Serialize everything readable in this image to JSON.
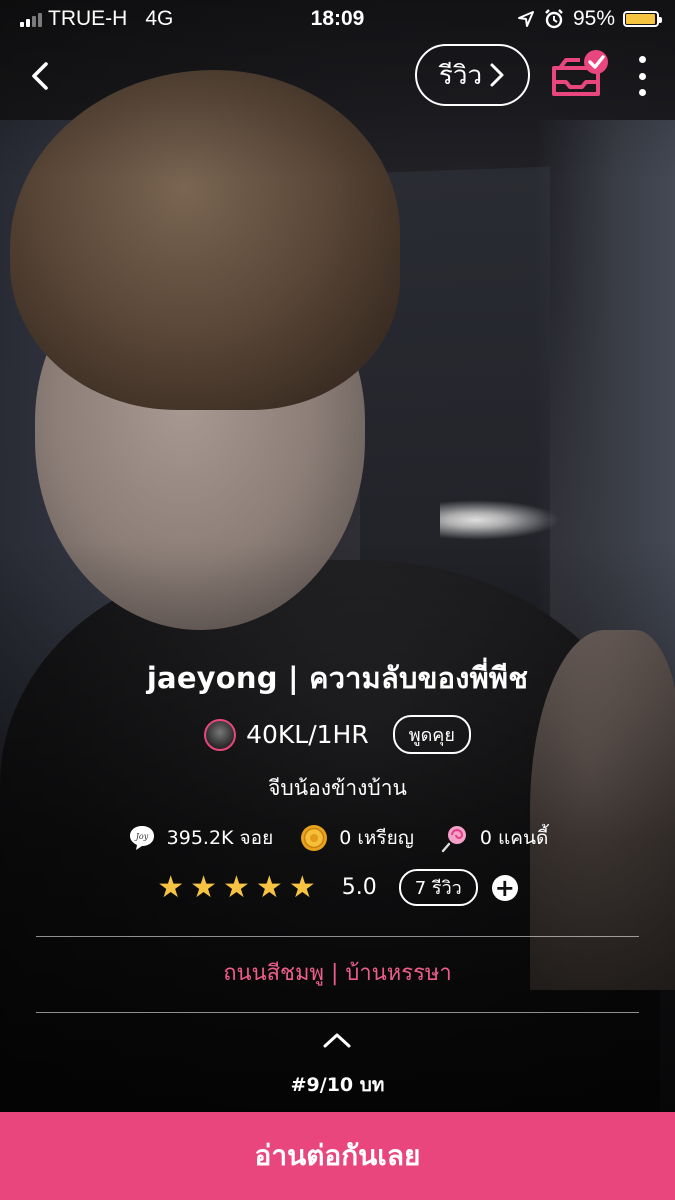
{
  "status_bar": {
    "carrier": "TRUE-H",
    "network": "4G",
    "time": "18:09",
    "battery_percent": "95%",
    "battery_level": 0.95,
    "battery_color": "#f5c542"
  },
  "nav": {
    "review_label": "รีวิว",
    "icons": [
      "back-chevron-icon",
      "chevron-right-icon",
      "inbox-check-icon",
      "more-vertical-icon"
    ]
  },
  "story": {
    "title": "jaeyong | ความลับของพี่พีช",
    "author": "40KL/1HR",
    "chat_label": "พูดคุย",
    "tagline": "จีบน้องข้างบ้าน",
    "joy_count": "395.2K จอย",
    "coin_count": "0 เหรียญ",
    "candy_count": "0 แคนดี้",
    "rating_value": "5.0",
    "stars": 5,
    "reviews_label": "7 รีวิว",
    "category": "ถนนสีชมพู | บ้านหรรษา",
    "episode": "#9/10 บท"
  },
  "cta": {
    "label": "อ่านต่อกันเลย"
  },
  "colors": {
    "accent": "#e8467c",
    "category_text": "#ec5c8c",
    "star": "#f6c343"
  }
}
